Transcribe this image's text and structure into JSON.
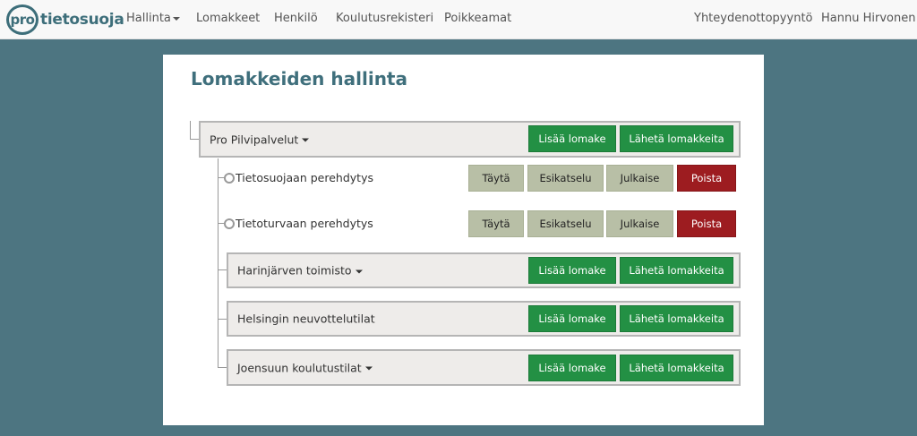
{
  "brand": {
    "badge": "pro",
    "name": "tietosuoja"
  },
  "nav": {
    "left": [
      {
        "label": "Hallinta"
      },
      {
        "label": "Lomakkeet"
      },
      {
        "label": "Henkilö"
      },
      {
        "label": "Koulutusrekisteri"
      },
      {
        "label": "Poikkeamat"
      }
    ],
    "right": [
      {
        "label": "Yhteydenottopyyntö"
      },
      {
        "label": "Hannu Hirvonen"
      }
    ]
  },
  "page": {
    "title": "Lomakkeiden hallinta"
  },
  "tree": {
    "root": {
      "name": "Pro Pilvipalvelut",
      "add_label": "Lisää lomake",
      "send_label": "Lähetä lomakkeita"
    },
    "forms": [
      {
        "name": "Tietosuojaan perehdytys",
        "fill": "Täytä",
        "preview": "Esikatselu",
        "publish": "Julkaise",
        "delete": "Poista"
      },
      {
        "name": "Tietoturvaan perehdytys",
        "fill": "Täytä",
        "preview": "Esikatselu",
        "publish": "Julkaise",
        "delete": "Poista"
      }
    ],
    "subgroups": [
      {
        "name": "Harinjärven toimisto",
        "add_label": "Lisää lomake",
        "send_label": "Lähetä lomakkeita"
      },
      {
        "name": "Helsingin neuvottelutilat",
        "add_label": "Lisää lomake",
        "send_label": "Lähetä lomakkeita"
      },
      {
        "name": "Joensuun koulutustilat",
        "add_label": "Lisää lomake",
        "send_label": "Lähetä lomakkeita"
      }
    ]
  },
  "colors": {
    "background": "#4d7581",
    "brand": "#3d6e7a",
    "green_button": "#239044",
    "grey_button": "#b8bfa6",
    "red_button": "#9d1c20"
  }
}
